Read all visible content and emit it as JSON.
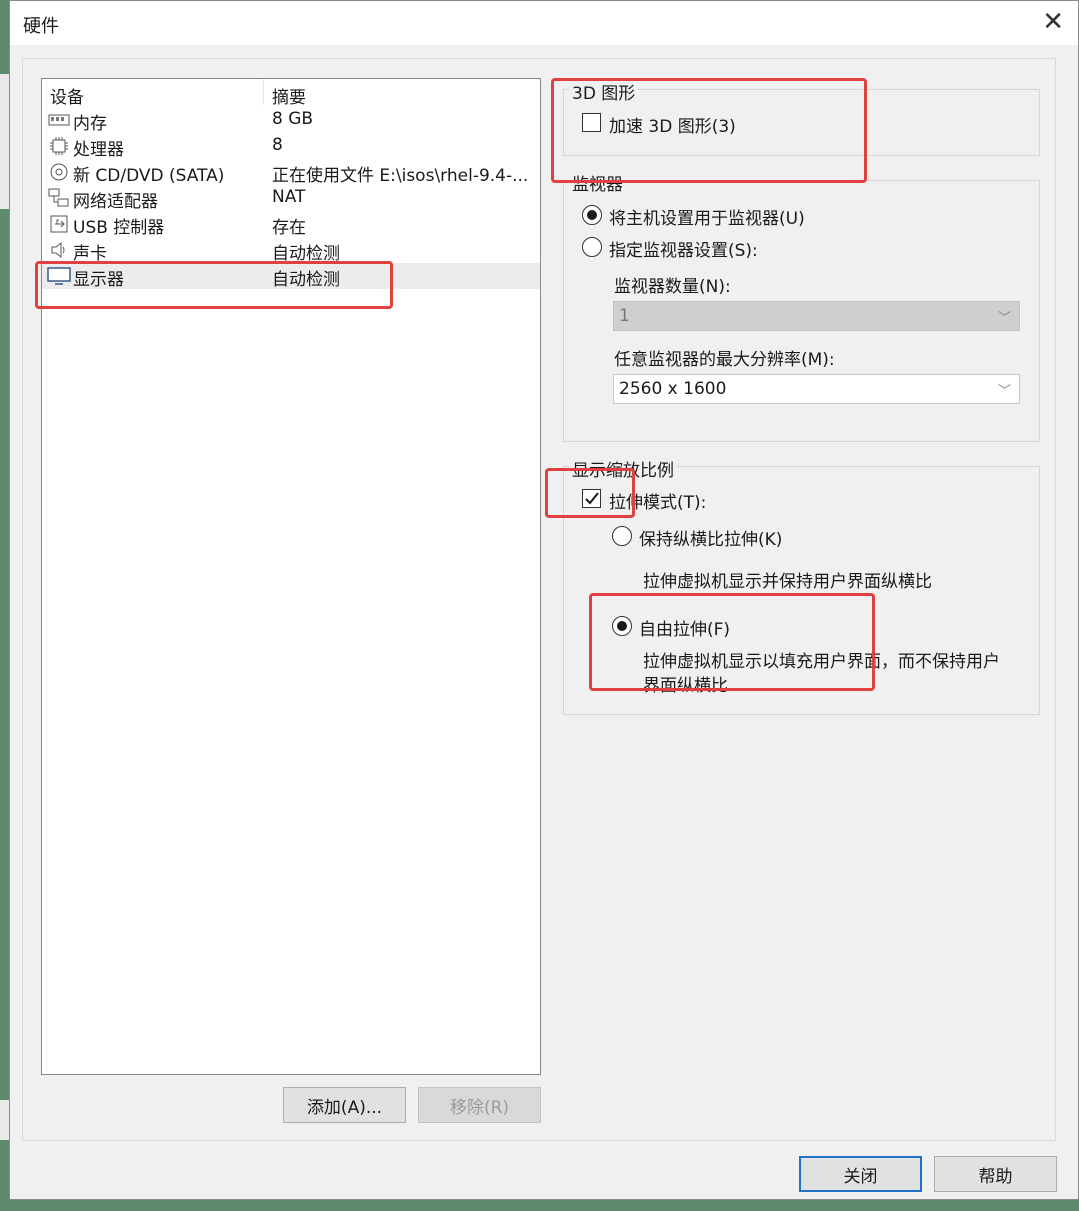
{
  "window": {
    "title": "硬件"
  },
  "list": {
    "col_device": "设备",
    "col_summary": "摘要",
    "rows": [
      {
        "name": "内存",
        "summary": "8 GB",
        "icon": "memory-icon"
      },
      {
        "name": "处理器",
        "summary": "8",
        "icon": "cpu-icon"
      },
      {
        "name": "新 CD/DVD (SATA)",
        "summary": "正在使用文件 E:\\isos\\rhel-9.4-...",
        "icon": "disc-icon"
      },
      {
        "name": "网络适配器",
        "summary": "NAT",
        "icon": "network-icon"
      },
      {
        "name": "USB 控制器",
        "summary": "存在",
        "icon": "usb-icon"
      },
      {
        "name": "声卡",
        "summary": "自动检测",
        "icon": "speaker-icon"
      },
      {
        "name": "显示器",
        "summary": "自动检测",
        "icon": "monitor-icon"
      }
    ]
  },
  "buttons": {
    "add": "添加(A)...",
    "remove": "移除(R)",
    "close": "关闭",
    "help": "帮助"
  },
  "graphics3d": {
    "title": "3D 图形",
    "accelerate": "加速 3D 图形(3)",
    "accelerate_checked": false
  },
  "monitor": {
    "title": "监视器",
    "use_host": "将主机设置用于监视器(U)",
    "specify": "指定监视器设置(S):",
    "count_label": "监视器数量(N):",
    "count_value": "1",
    "maxres_label": "任意监视器的最大分辨率(M):",
    "maxres_value": "2560 x 1600"
  },
  "scaling": {
    "title": "显示缩放比例",
    "stretch": "拉伸模式(T):",
    "stretch_checked": true,
    "keep_aspect": "保持纵横比拉伸(K)",
    "keep_aspect_desc": "拉伸虚拟机显示并保持用户界面纵横比",
    "free": "自由拉伸(F)",
    "free_desc": "拉伸虚拟机显示以填充用户界面，而不保持用户界面纵横比"
  },
  "colors": {
    "highlight": "#e0413e",
    "accent": "#1e73c8"
  }
}
